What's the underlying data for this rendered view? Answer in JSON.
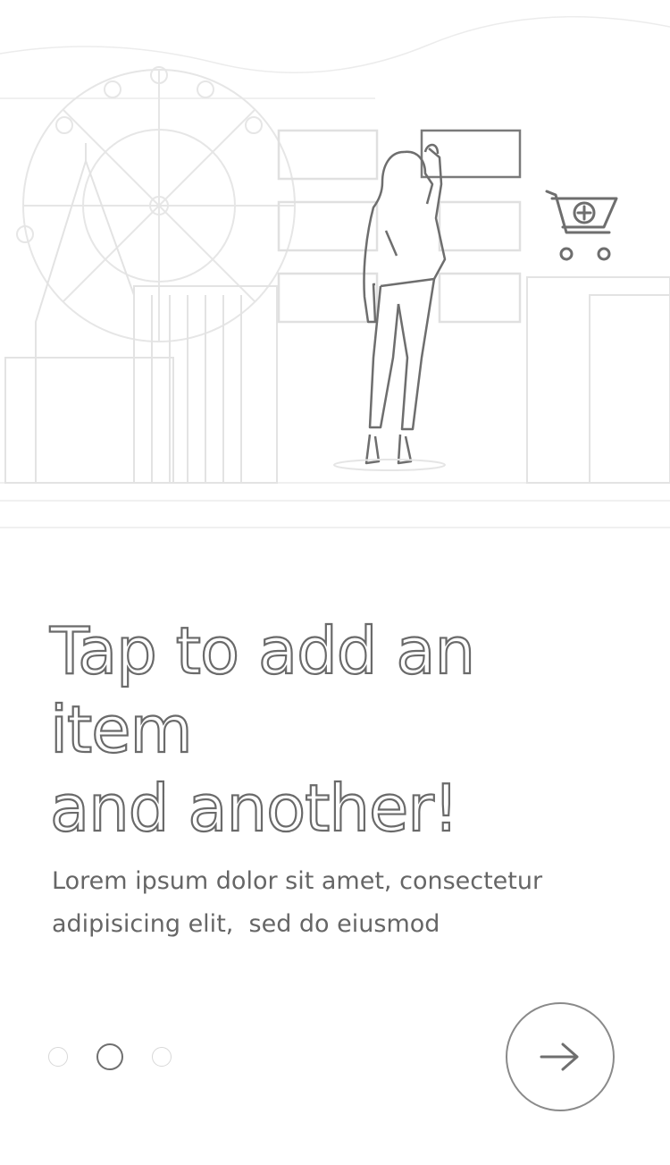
{
  "onboarding": {
    "headline_lines": [
      "Tap to add an",
      "item",
      "and another!"
    ],
    "body_lines": [
      "Lorem ipsum dolor sit amet, consectetur",
      "adipisicing elit,  sed do eiusmod"
    ],
    "pagination": {
      "total": 3,
      "active_index": 1
    },
    "next_button_icon": "arrow-right-icon"
  },
  "illustration": {
    "scene": "woman-placing-items-on-shelf-city-background",
    "cart_icon": "cart-plus-icon"
  },
  "colors": {
    "outline": "#6a6a6a",
    "light_line": "#e2e2e2",
    "background": "#ffffff"
  }
}
